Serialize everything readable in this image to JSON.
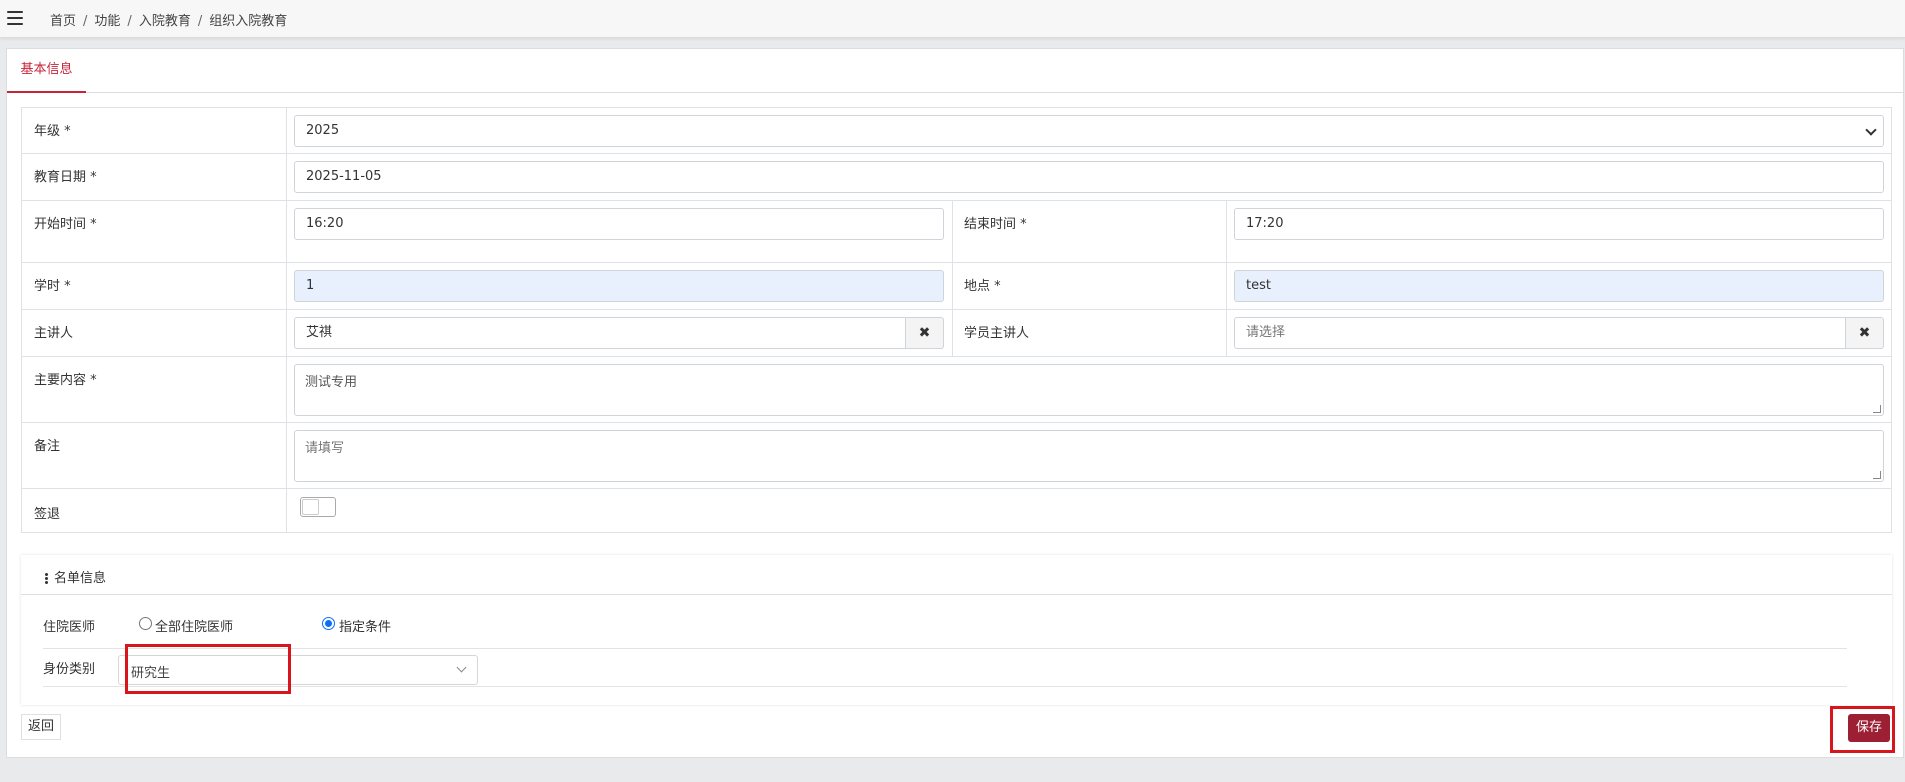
{
  "breadcrumb": [
    "首页",
    "功能",
    "入院教育",
    "组织入院教育"
  ],
  "tabs": {
    "active": "基本信息"
  },
  "form": {
    "grade": {
      "label": "年级 *",
      "value": "2025"
    },
    "edu_date": {
      "label": "教育日期 *",
      "value": "2025-11-05"
    },
    "start_time": {
      "label": "开始时间 *",
      "value": "16:20"
    },
    "end_time": {
      "label": "结束时间 *",
      "value": "17:20"
    },
    "hours": {
      "label": "学时 *",
      "value": "1"
    },
    "location": {
      "label": "地点 *",
      "value": "test"
    },
    "speaker": {
      "label": "主讲人",
      "value": "艾祺",
      "clear": "✖"
    },
    "student_speaker": {
      "label": "学员主讲人",
      "placeholder": "请选择",
      "clear": "✖"
    },
    "main_content": {
      "label": "主要内容 *",
      "value": "测试专用"
    },
    "remark": {
      "label": "备注",
      "placeholder": "请填写"
    },
    "signout": {
      "label": "签退",
      "checked": false
    }
  },
  "list_section": {
    "title": "名单信息",
    "resident": {
      "label": "住院医师",
      "options": [
        "全部住院医师",
        "指定条件"
      ],
      "selected": "指定条件"
    },
    "identity": {
      "label": "身份类别",
      "value": "研究生"
    }
  },
  "buttons": {
    "back": "返回",
    "save": "保存"
  },
  "colors": {
    "accent": "#c7243a",
    "save_bg": "#9c1f33",
    "highlight_box": "#d6161c",
    "autofill_bg": "#e8f0fe"
  }
}
